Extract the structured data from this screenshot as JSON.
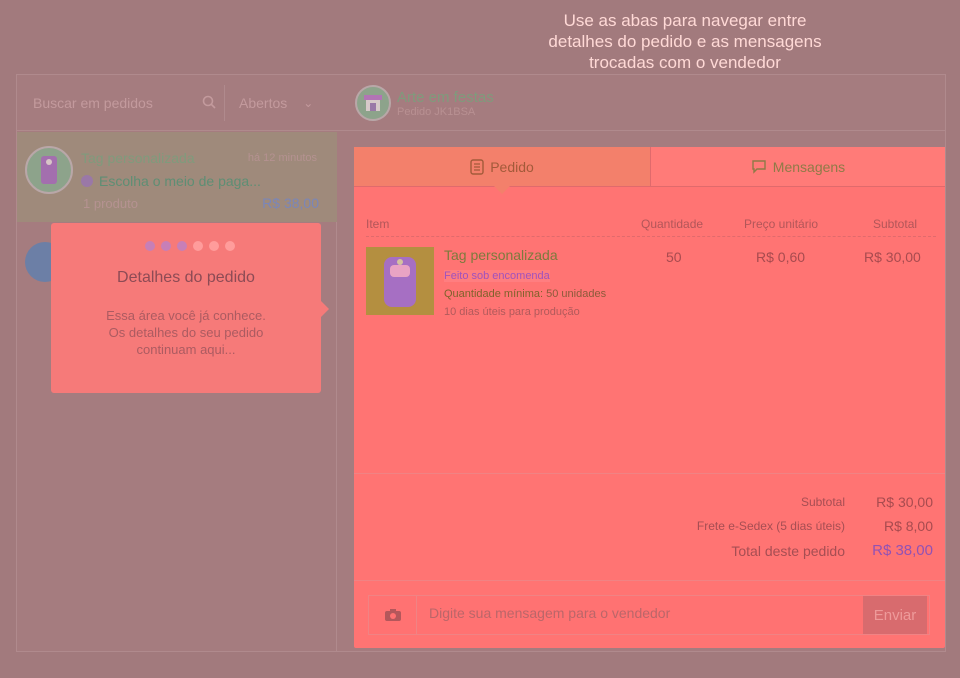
{
  "annotation": {
    "line1": "Use as abas para navegar entre",
    "line2": "detalhes do pedido e as mensagens",
    "line3": "trocadas com o vendedor"
  },
  "search": {
    "placeholder": "Buscar em pedidos"
  },
  "status_filter": {
    "selected": "Abertos"
  },
  "vendor": {
    "name": "Arte em festas",
    "order_code": "Pedido JK1BSA"
  },
  "orders": [
    {
      "title": "Tag personalizada",
      "time": "há 12 minutos",
      "message": "Escolha o meio de paga...",
      "count": "1 produto",
      "price": "R$ 38,00"
    }
  ],
  "tooltip": {
    "title": "Detalhes do pedido",
    "body_line1": "Essa área você já conhece.",
    "body_line2": "Os detalhes do seu pedido",
    "body_line3": "continuam aqui..."
  },
  "tabs": {
    "order": "Pedido",
    "messages": "Mensagens"
  },
  "table": {
    "headers": {
      "item": "Item",
      "quantity": "Quantidade",
      "unit_price": "Preço unitário",
      "subtotal": "Subtotal"
    },
    "row": {
      "name": "Tag personalizada",
      "made_to_order": "Feito sob encomenda",
      "min_label": "Quantidade mínima:",
      "min_value": "50 unidades",
      "production": "10 dias úteis para produção",
      "quantity": "50",
      "unit_price": "R$ 0,60",
      "subtotal": "R$ 30,00"
    }
  },
  "totals": {
    "subtotal_label": "Subtotal",
    "subtotal_value": "R$ 30,00",
    "shipping_label": "Frete e-Sedex (5 dias úteis)",
    "shipping_value": "R$ 8,00",
    "total_label": "Total deste pedido",
    "total_value": "R$ 38,00"
  },
  "composer": {
    "placeholder": "Digite sua mensagem para o vendedor",
    "send": "Enviar"
  },
  "colors": {
    "overlay": "#a27a7d",
    "panel": "#ff7473",
    "accent_purple": "#9252b4"
  }
}
